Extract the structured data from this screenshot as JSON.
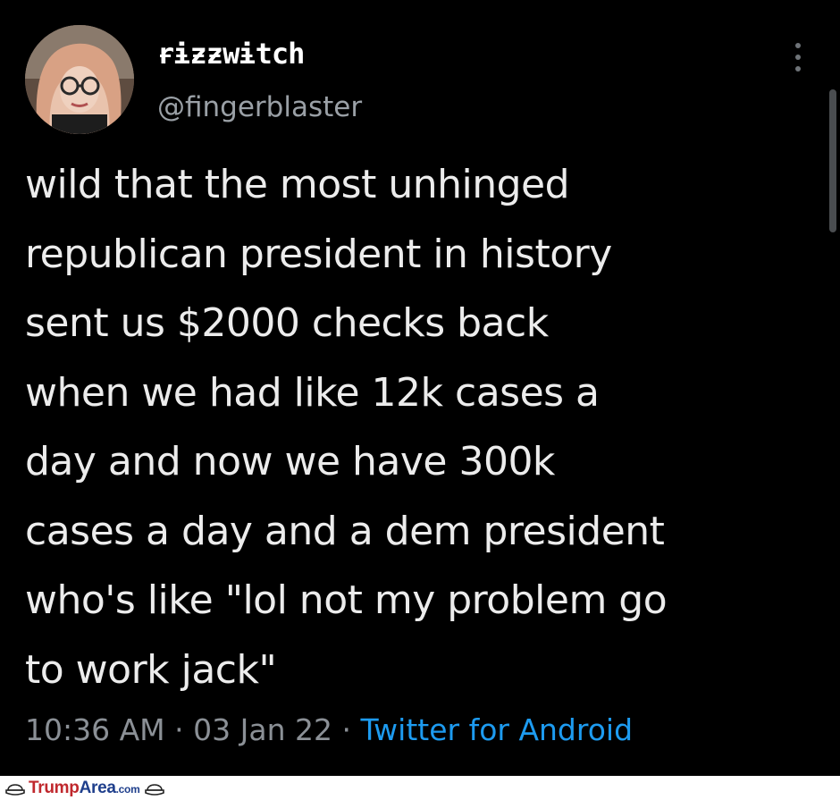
{
  "tweet": {
    "display_name": "ɍɨƶƶwɨtch",
    "handle": "@fingerblaster",
    "text_lines": [
      "wild that the most unhinged",
      "republican president in history",
      "sent us $2000 checks back",
      "when we had like 12k cases a",
      "day and now we have 300k",
      "cases a day and a dem president",
      "who's like \"lol not my problem go",
      "to work jack\""
    ],
    "time": "10:36 AM",
    "separator": "·",
    "date": "03 Jan 22",
    "source": "Twitter for Android"
  },
  "icons": {
    "more": "more-vertical-icon",
    "avatar": "profile-photo"
  },
  "watermark": {
    "brand_red": "Trump",
    "brand_blue": "Area",
    "suffix": ".com"
  },
  "colors": {
    "background": "#000000",
    "text": "#ececec",
    "muted": "#8b9096",
    "link": "#1d9bf0"
  }
}
